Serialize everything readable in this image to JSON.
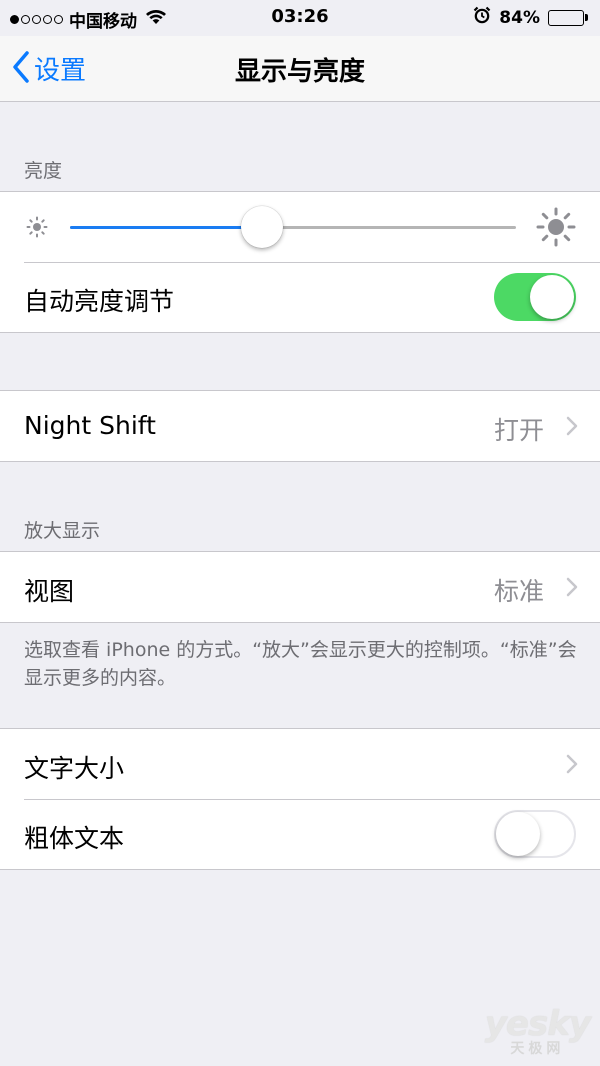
{
  "status_bar": {
    "carrier": "中国移动",
    "time": "03:26",
    "battery_text": "84%",
    "battery_level": 0.84,
    "signal_strength": 1
  },
  "nav": {
    "back_label": "设置",
    "title": "显示与亮度"
  },
  "brightness_section": {
    "header": "亮度",
    "slider_value": 0.43,
    "auto_label": "自动亮度调节",
    "auto_enabled": true
  },
  "night_shift": {
    "label": "Night Shift",
    "value": "打开"
  },
  "zoom_section": {
    "header": "放大显示",
    "view_label": "视图",
    "view_value": "标准",
    "footer": "选取查看 iPhone 的方式。“放大”会显示更大的控制项。“标准”会显示更多的内容。"
  },
  "text_section": {
    "text_size_label": "文字大小",
    "bold_text_label": "粗体文本",
    "bold_enabled": false
  },
  "watermark": {
    "logo": "yesky",
    "sub": "天极网"
  },
  "colors": {
    "accent": "#0a7aff",
    "toggle_on": "#4cd964",
    "slider_fill": "#1a7cf2",
    "background": "#efeff4"
  }
}
